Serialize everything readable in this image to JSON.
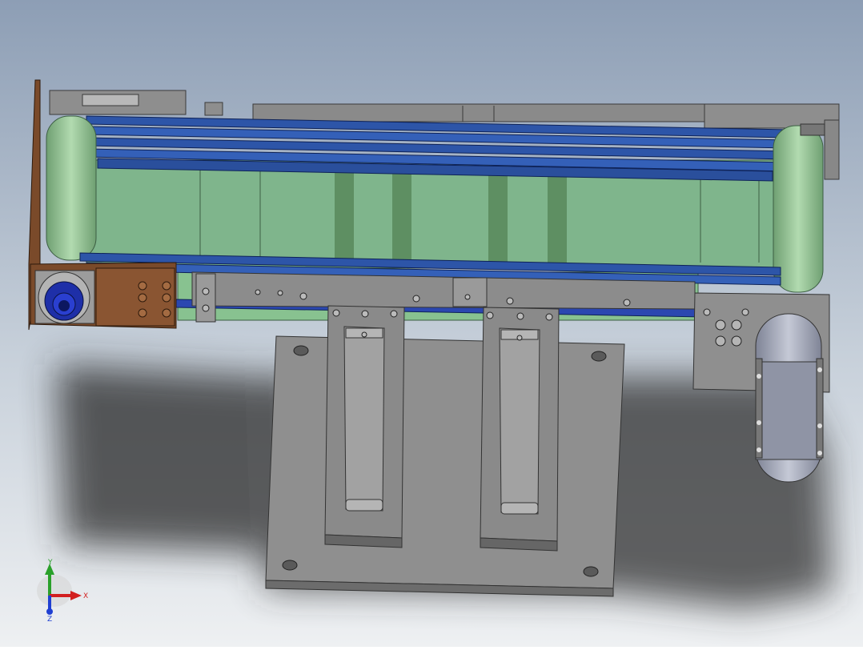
{
  "viewport": {
    "background_top": "#8d9eb5",
    "background_bottom": "#e9ecef",
    "colors": {
      "frame_gray": "#8c8c8c",
      "frame_dark": "#5f5f5f",
      "belt_green": "#7fb58c",
      "roller_green": "#9cc79a",
      "blue_rail": "#2d55a8",
      "bracket_brown": "#7a4a2a",
      "motor_gray": "#a7acba"
    }
  },
  "triad": {
    "x_label": "X",
    "y_label": "Y",
    "z_label": "Z",
    "x_color": "#d21f1f",
    "y_color": "#2aa02a",
    "z_color": "#1f3fd2"
  }
}
